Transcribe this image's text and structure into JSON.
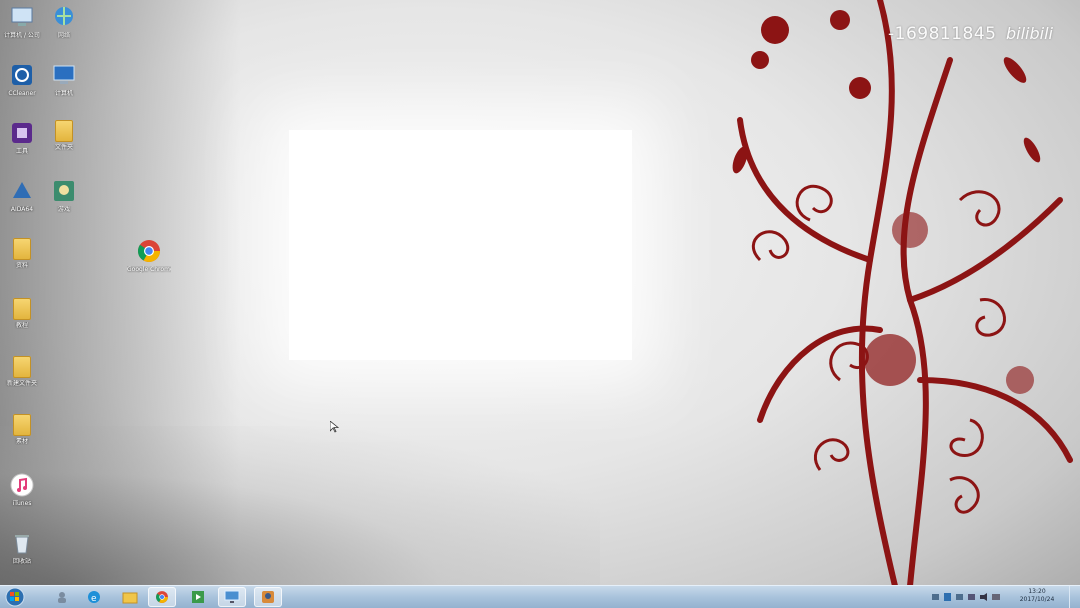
{
  "watermark": {
    "id_text": "-169811845",
    "logo_text": "bilibili"
  },
  "desktop": {
    "icons": [
      {
        "name": "desktop-icon-computer",
        "label": "计算机 / 公司",
        "kind": "app-computer"
      },
      {
        "name": "desktop-icon-network",
        "label": "网络",
        "kind": "app-network"
      },
      {
        "name": "desktop-icon-ccleaner",
        "label": "CCleaner",
        "kind": "app-blue"
      },
      {
        "name": "desktop-icon-computer2",
        "label": "计算机",
        "kind": "app-monitor"
      },
      {
        "name": "desktop-icon-tool",
        "label": "工具",
        "kind": "app-purple"
      },
      {
        "name": "desktop-icon-folder-a",
        "label": "文件夹",
        "kind": "folder"
      },
      {
        "name": "desktop-icon-aida",
        "label": "AIDA64",
        "kind": "app-blue"
      },
      {
        "name": "desktop-icon-game",
        "label": "游戏",
        "kind": "app-game"
      },
      {
        "name": "desktop-icon-folder-b",
        "label": "资料",
        "kind": "folder"
      },
      {
        "name": "desktop-icon-chrome",
        "label": "Google Chrome",
        "kind": "chrome"
      },
      {
        "name": "desktop-icon-folder-c",
        "label": "教程",
        "kind": "folder"
      },
      {
        "name": "desktop-icon-folder-d",
        "label": "新建文件夹",
        "kind": "folder"
      },
      {
        "name": "desktop-icon-folder-e",
        "label": "素材",
        "kind": "folder"
      },
      {
        "name": "desktop-icon-itunes",
        "label": "iTunes",
        "kind": "itunes"
      },
      {
        "name": "desktop-icon-recycle-bin",
        "label": "回收站",
        "kind": "recycle"
      }
    ]
  },
  "taskbar": {
    "pinned": [
      "ie-icon",
      "explorer-icon",
      "chrome-icon",
      "media-icon",
      "monitor-icon",
      "app-icon"
    ],
    "clock_time": "13:20",
    "clock_date": "2017/10/24"
  }
}
